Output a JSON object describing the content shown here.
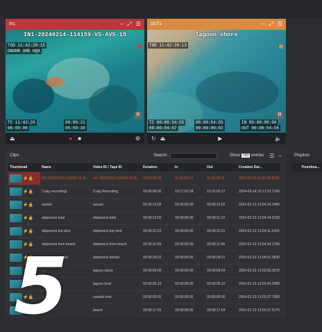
{
  "players": {
    "in": {
      "label": "IN1",
      "title": "IN1-20240214-114159-VS-AVS-15",
      "tod": "TOD 11:42:20:15",
      "format": "DNXHR UHD HQX",
      "tc": "TC 11:42:20",
      "tc2": "06:00:00",
      "dur": "00:00:21",
      "rem": "05:59:39",
      "badge": "R"
    },
    "out": {
      "label": "OUT1",
      "title": "lagoon shore",
      "tod": "TOD 11:42:20:13",
      "tc": "TC 00:00:54:55",
      "tc2": "00:00:54:57",
      "dur": "00:00:54:55",
      "rem": "00:00:00:02",
      "in": "IN 00:00:00:00",
      "outtc": "OUT 00:00:54:56",
      "badge": "R"
    }
  },
  "clips": {
    "title": "Clips",
    "search_label": "Search:",
    "show_label": "Show",
    "show_value": "100",
    "entries_label": "entries",
    "columns": [
      "Thumbnail",
      "Name",
      "Video ID / Tape ID",
      "Duration",
      "In",
      "Out",
      "Creation Dat..."
    ],
    "rows": [
      [
        "IN1-20240214-114159-VS-A...",
        "IN1-20240214-114159-VS-A...",
        "00:00:22:08",
        "11:41:59:14",
        "11:42:20:21",
        "2024-02-14 11:41:59.6300"
      ],
      [
        "Craig recording1",
        "Craig Recording",
        "00:05:00:00",
        "10:17:52:18",
        "10:22:52:17",
        "2024-02-14 10:17:52.7160"
      ],
      [
        "sunset",
        "sunset",
        "00:00:10:03",
        "00:00:00:00",
        "00:00:10:02",
        "2024-02-13 13:04:16.3490"
      ],
      [
        "shipwreck total",
        "shipwreck total",
        "00:00:12:00",
        "00:00:00:00",
        "00:00:11:24",
        "2024-02-13 13:04:14.0120"
      ],
      [
        "shipwreck top shot",
        "shipwreck top shot",
        "00:00:31:22",
        "00:00:00:00",
        "00:00:31:21",
        "2024-02-13 13:04:11.2420"
      ],
      [
        "shipwreck from beach",
        "shipwreck from beach",
        "00:00:11:09",
        "00:00:00:00",
        "00:00:11:08",
        "2024-02-13 13:04:04.1780"
      ],
      [
        "shipwreck details",
        "shipwreck details",
        "00:00:28:22",
        "00:00:00:00",
        "00:00:28:21",
        "2024-02-13 13:04:01.0830"
      ],
      [
        "...",
        "lagoon shore",
        "00:00:55:00",
        "00:00:00:00",
        "00:00:54:24",
        "2024-02-13 13:03:59.3570"
      ],
      [
        "lagoon boat",
        "lagoon boat",
        "00:00:25:13",
        "00:00:00:00",
        "00:00:25:12",
        "2024-02-13 13:03:43.2680"
      ],
      [
        "...",
        "coastal shot",
        "00:00:00:01",
        "00:00:00:00",
        "00:00:00:00",
        "2024-02-13 13:03:37.7380"
      ],
      [
        "be...",
        "beach",
        "00:00:17:05",
        "00:00:00:00",
        "00:00:17:04",
        "2024-02-13 13:03:37.5170"
      ]
    ]
  },
  "playlists": {
    "title": "Playlists",
    "column": "Thumbna..."
  },
  "overlay_number": "5",
  "colors": {
    "in_header": "#b8383d",
    "out_header": "#d98a43",
    "active_row_text": "#e0533b"
  }
}
